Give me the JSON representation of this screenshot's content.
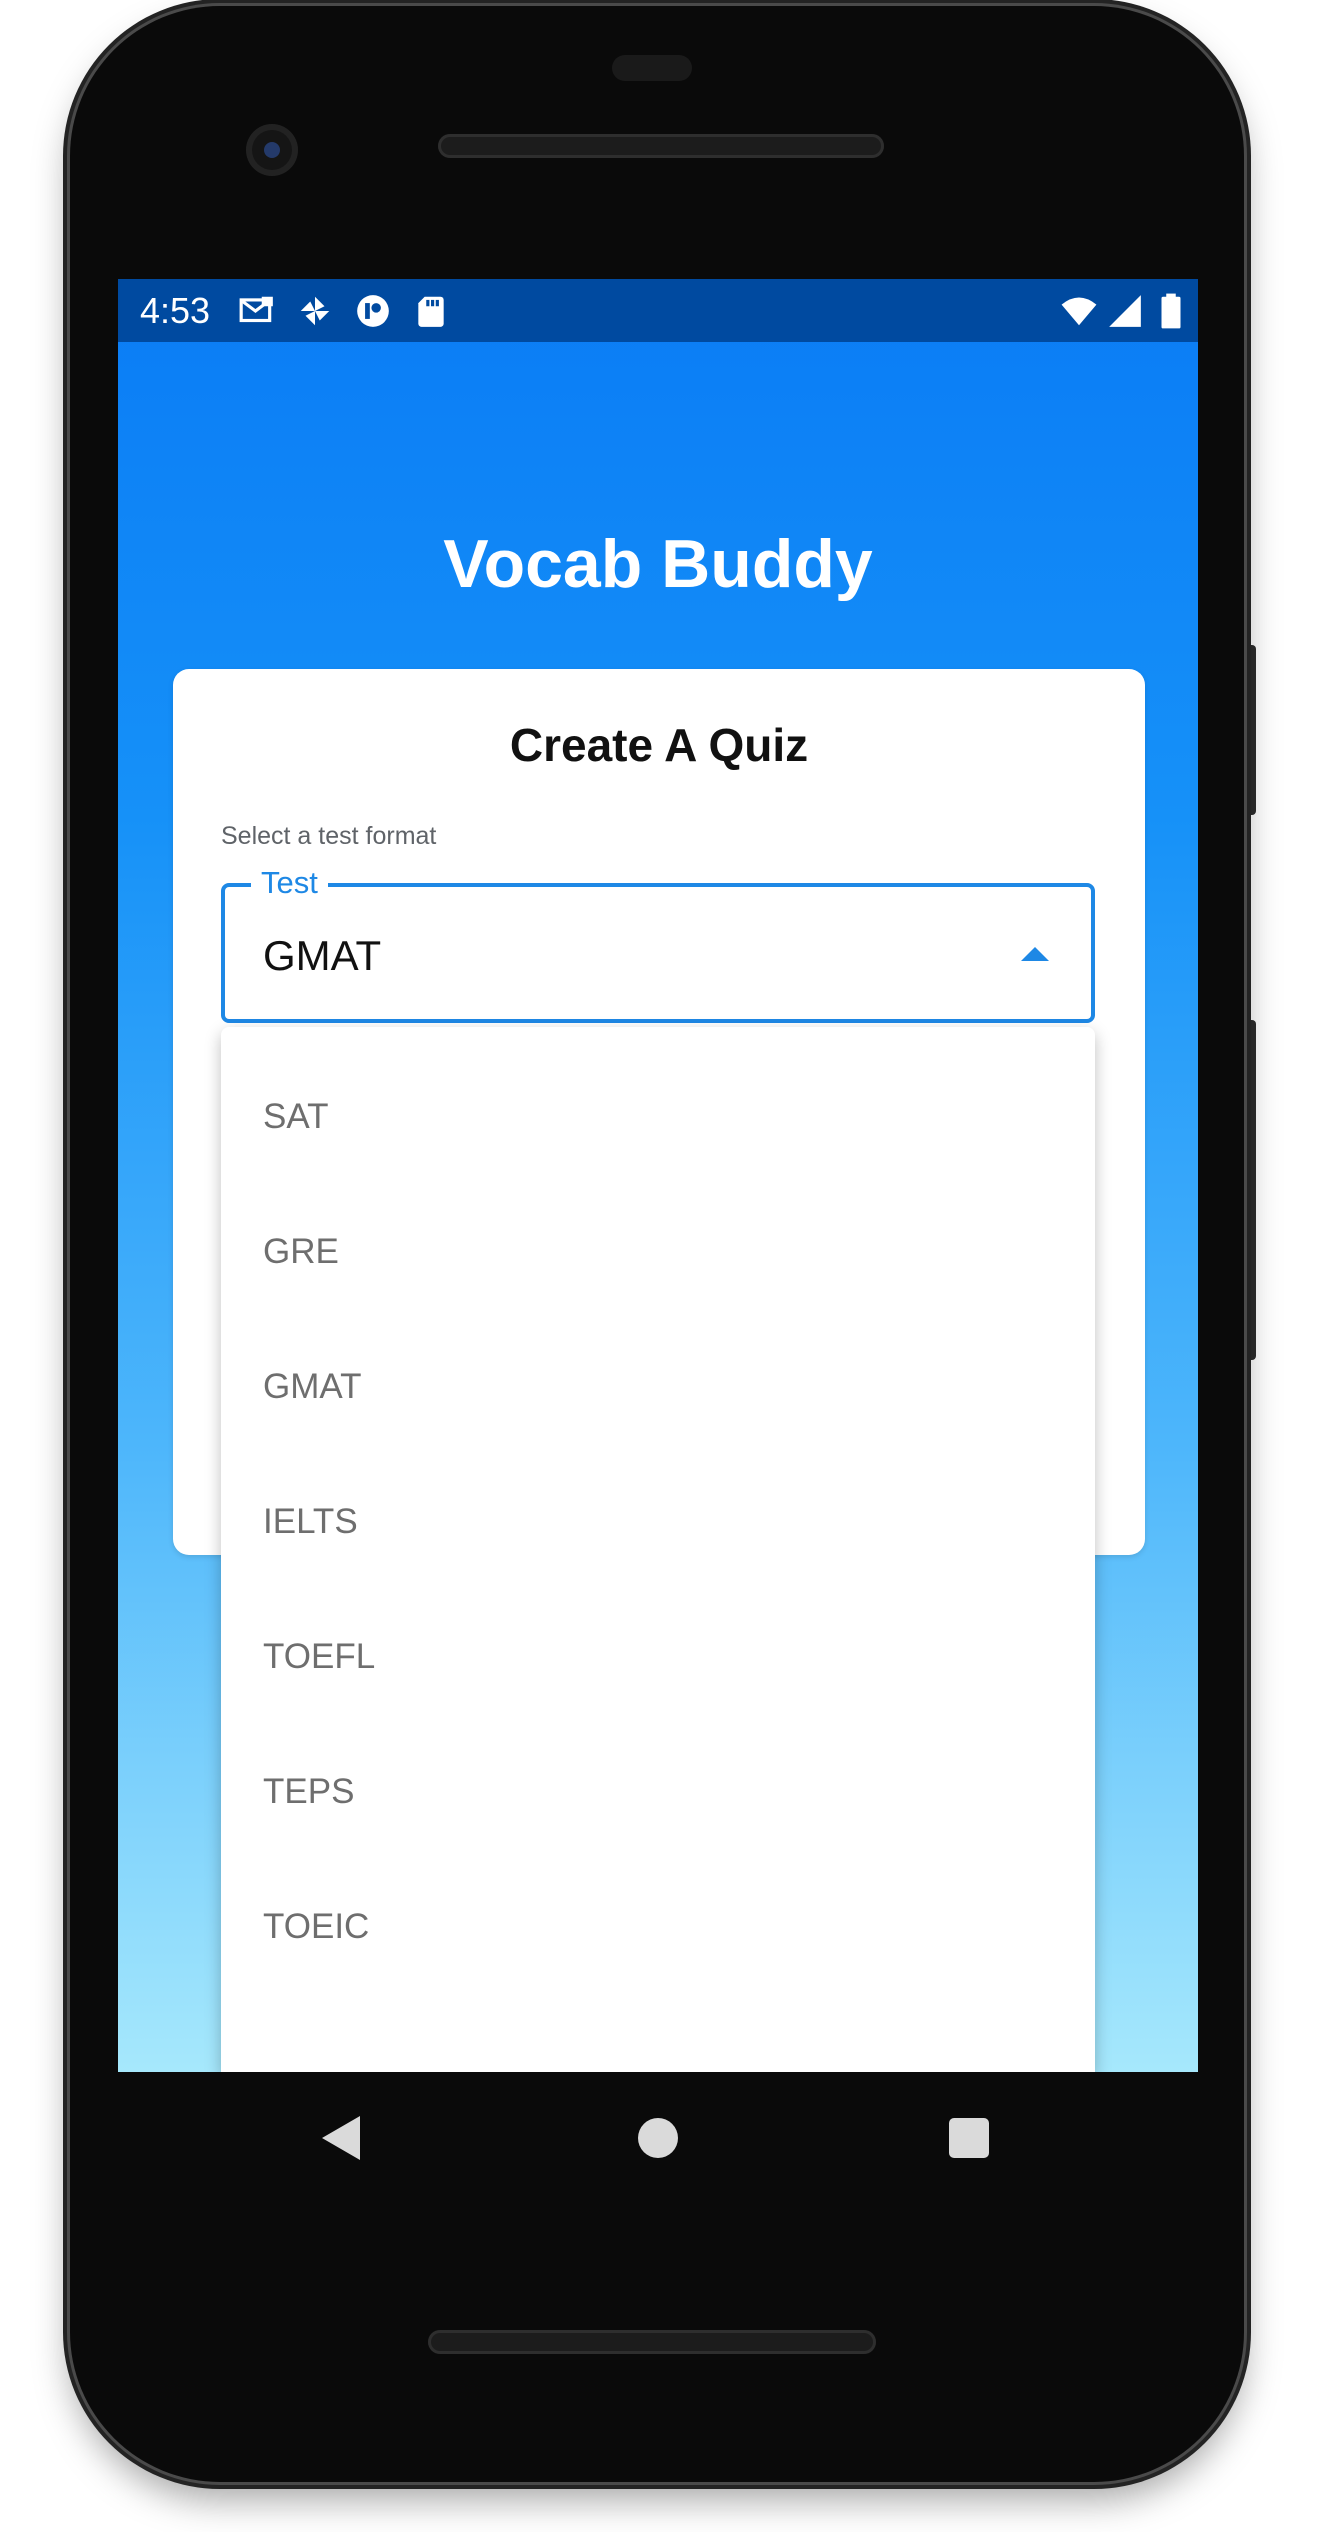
{
  "status_bar": {
    "time": "4:53",
    "left_icons": [
      "gmail-icon",
      "pinwheel-icon",
      "app-icon",
      "sd-card-icon"
    ],
    "right_icons": [
      "wifi-icon",
      "signal-icon",
      "battery-icon"
    ]
  },
  "app": {
    "title": "Vocab Buddy"
  },
  "card": {
    "title": "Create A Quiz",
    "helper_text": "Select a test format",
    "select": {
      "label": "Test",
      "value": "GMAT",
      "expanded": true
    }
  },
  "dropdown": {
    "options": [
      "SAT",
      "GRE",
      "GMAT",
      "IELTS",
      "TOEFL",
      "TEPS",
      "TOEIC"
    ]
  },
  "colors": {
    "accent": "#1e88e5",
    "status_bar": "#004aa0",
    "gradient_top": "#0a7cf5",
    "gradient_bottom": "#a6e8fc"
  },
  "nav": {
    "icons": [
      "back-icon",
      "home-icon",
      "recents-icon"
    ]
  }
}
